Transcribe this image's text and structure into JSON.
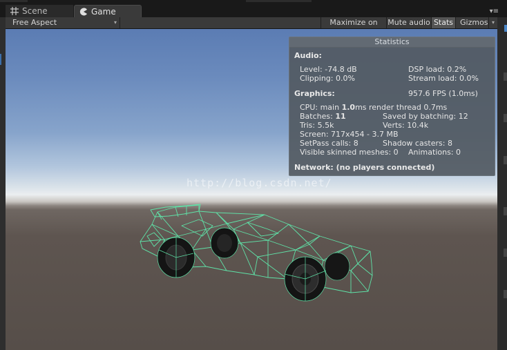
{
  "tabs": [
    {
      "label": "Scene",
      "icon": "grid-icon",
      "active": false
    },
    {
      "label": "Game",
      "icon": "pacman-icon",
      "active": true
    }
  ],
  "toolbar": {
    "aspect": "Free Aspect",
    "maximize_label": "Maximize on Play",
    "mute_label": "Mute audio",
    "stats_label": "Stats",
    "gizmos_label": "Gizmos"
  },
  "watermark": "http://blog.csdn.net/",
  "stats": {
    "title": "Statistics",
    "audio": {
      "heading": "Audio:",
      "level": "Level: -74.8 dB",
      "clipping": "Clipping: 0.0%",
      "dsp": "DSP load: 0.2%",
      "stream": "Stream load: 0.0%"
    },
    "graphics": {
      "heading": "Graphics:",
      "fps": "957.6 FPS (1.0ms)",
      "cpu_prefix": "CPU: main ",
      "cpu_main": "1.0",
      "cpu_suffix": "ms  render thread 0.7ms",
      "batches_prefix": "Batches: ",
      "batches": "11",
      "saved": "Saved by batching: 12",
      "tris": "Tris: 5.5k",
      "verts": "Verts: 10.4k",
      "screen": "Screen: 717x454 - 3.7 MB",
      "setpass": "SetPass calls: 8",
      "shadow": "Shadow casters: 8",
      "skinned": "Visible skinned meshes: 0",
      "animations": "Animations: 0"
    },
    "network": "Network: (no players connected)"
  },
  "colors": {
    "wireframe": "#5fe3a8",
    "panel": "#525a62",
    "accent": "#3d6fa8"
  }
}
